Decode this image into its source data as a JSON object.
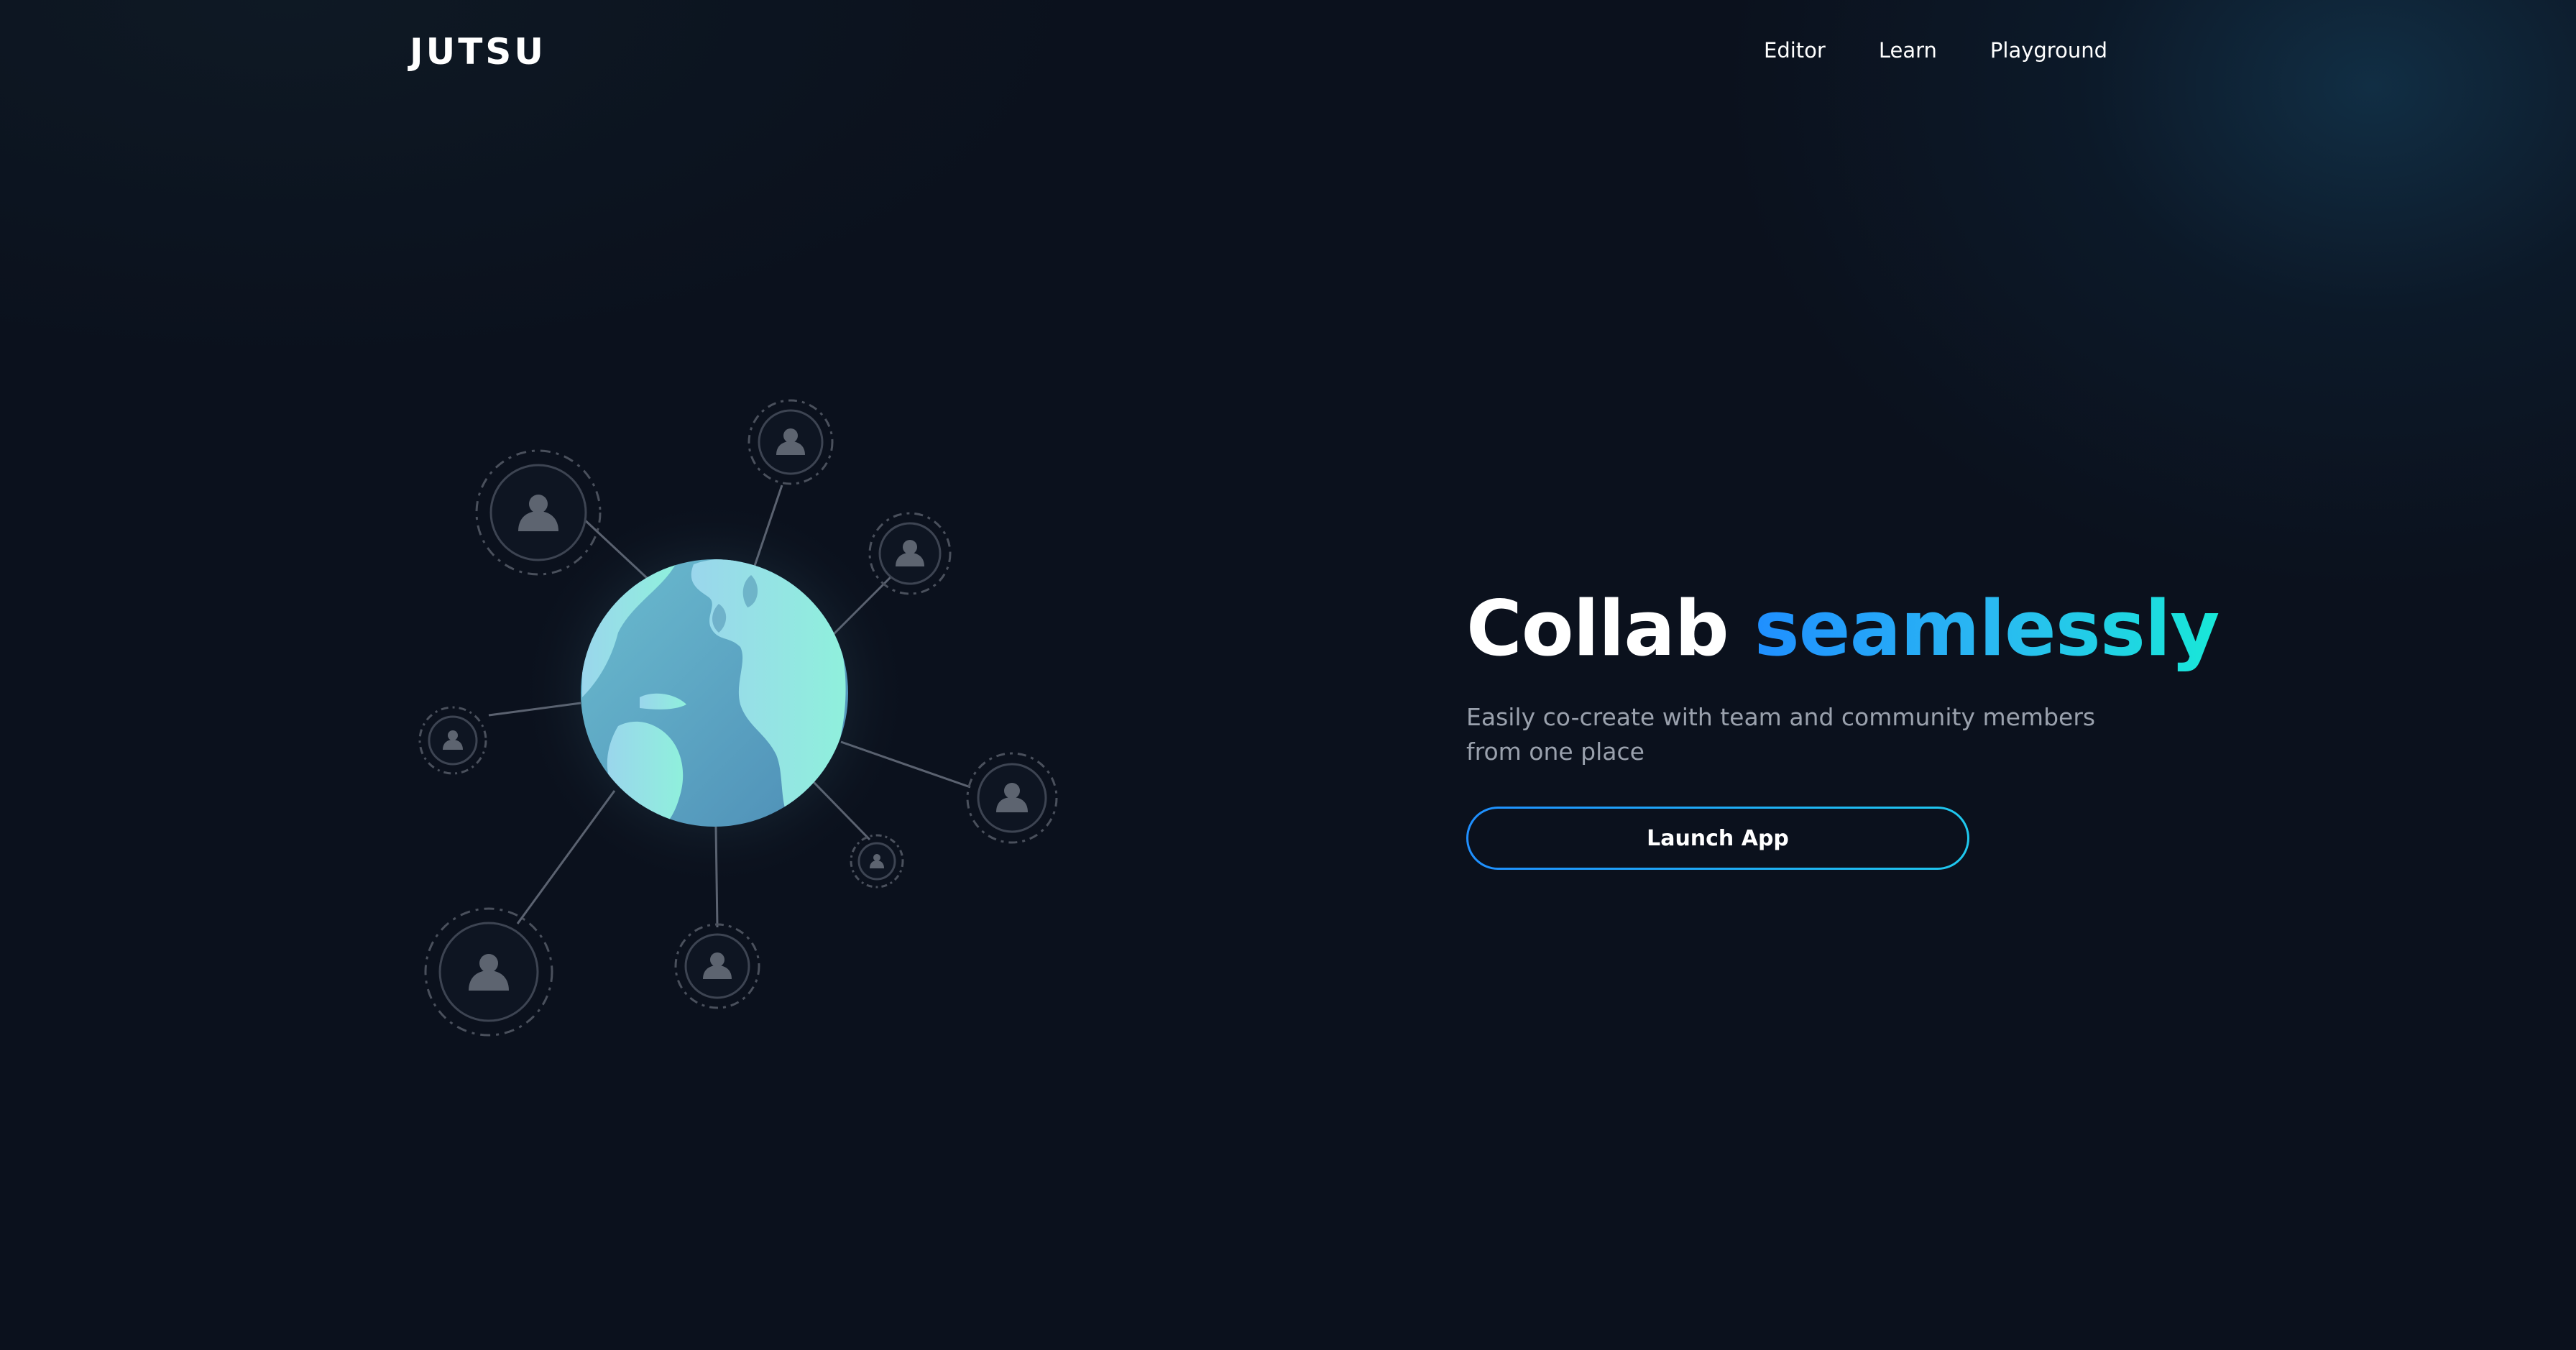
{
  "header": {
    "logo_text": "JUTSU",
    "nav": [
      {
        "label": "Editor"
      },
      {
        "label": "Learn"
      },
      {
        "label": "Playground"
      }
    ]
  },
  "hero": {
    "title_plain": "Collab ",
    "title_accent": "seamlessly",
    "subtitle": "Easily co-create with team and community members from one place",
    "cta_label": "Launch App"
  },
  "illustration": {
    "center_icon": "globe-icon",
    "node_icon": "user-avatar-icon",
    "node_count": 8
  },
  "colors": {
    "background": "#0b111d",
    "accent_start": "#1f8fff",
    "accent_end": "#18e8d8",
    "globe_ocean": "#5aa6c4",
    "globe_land": "#8fe8da"
  }
}
